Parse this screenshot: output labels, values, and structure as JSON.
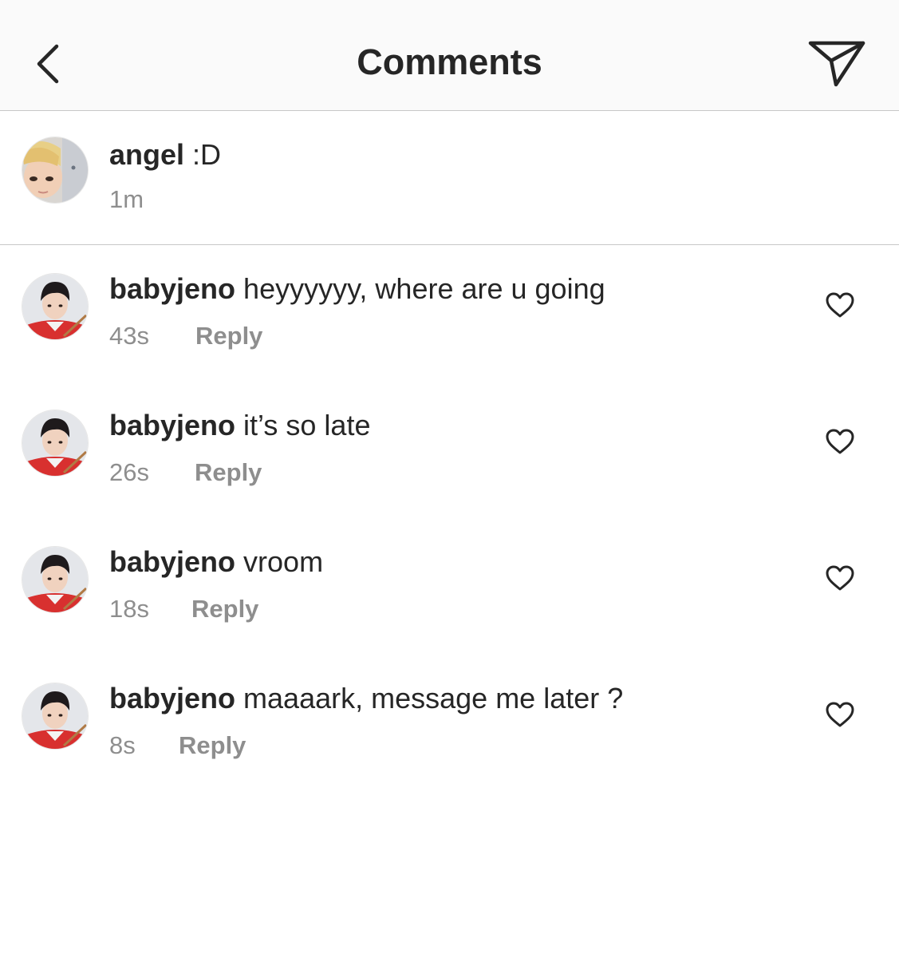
{
  "header": {
    "title": "Comments",
    "back_icon": "chevron-left-icon",
    "share_icon": "paper-plane-icon"
  },
  "caption": {
    "username": "angel",
    "text": ":D",
    "time": "1m"
  },
  "comments": [
    {
      "username": "babyjeno",
      "text": "heyyyyyy, where are u going",
      "time": "43s",
      "reply_label": "Reply"
    },
    {
      "username": "babyjeno",
      "text": "it’s so late",
      "time": "26s",
      "reply_label": "Reply"
    },
    {
      "username": "babyjeno",
      "text": "vroom",
      "time": "18s",
      "reply_label": "Reply"
    },
    {
      "username": "babyjeno",
      "text": "maaaark, message me later  ?",
      "time": "8s",
      "reply_label": "Reply"
    }
  ],
  "colors": {
    "text": "#262626",
    "muted": "#8e8e8e",
    "divider": "#c7c7c7",
    "header_bg": "#fafafa"
  }
}
